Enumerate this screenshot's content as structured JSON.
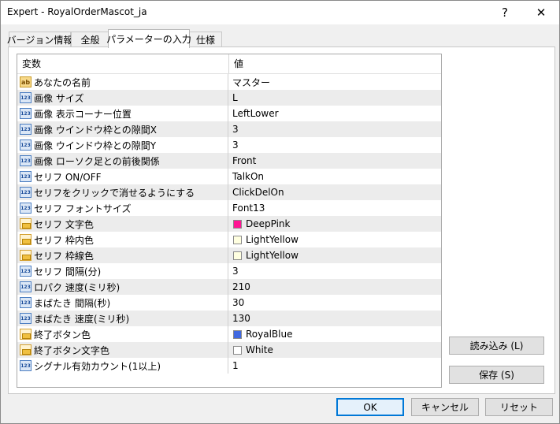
{
  "window": {
    "title": "Expert - RoyalOrderMascot_ja",
    "help_glyph": "?",
    "close_glyph": "✕"
  },
  "tabs": [
    {
      "label": "バージョン情報"
    },
    {
      "label": "全般"
    },
    {
      "label": "パラメーターの入力",
      "active": true
    },
    {
      "label": "仕様"
    }
  ],
  "grid": {
    "col_name": "変数",
    "col_value": "値",
    "rows": [
      {
        "type": "str",
        "name": "あなたの名前",
        "value": "マスター"
      },
      {
        "type": "num",
        "name": "画像 サイズ",
        "value": "L"
      },
      {
        "type": "num",
        "name": "画像 表示コーナー位置",
        "value": "LeftLower"
      },
      {
        "type": "num",
        "name": "画像 ウインドウ枠との隙間X",
        "value": "3"
      },
      {
        "type": "num",
        "name": "画像 ウインドウ枠との隙間Y",
        "value": "3"
      },
      {
        "type": "num",
        "name": "画像 ローソク足との前後関係",
        "value": "Front"
      },
      {
        "type": "num",
        "name": "セリフ ON/OFF",
        "value": "TalkOn"
      },
      {
        "type": "num",
        "name": "セリフをクリックで消せるようにする",
        "value": "ClickDelOn"
      },
      {
        "type": "num",
        "name": "セリフ フォントサイズ",
        "value": "Font13"
      },
      {
        "type": "col",
        "name": "セリフ 文字色",
        "value": "DeepPink",
        "color": "#ff1493"
      },
      {
        "type": "col",
        "name": "セリフ 枠内色",
        "value": "LightYellow",
        "color": "#ffffe0"
      },
      {
        "type": "col",
        "name": "セリフ 枠線色",
        "value": "LightYellow",
        "color": "#ffffe0"
      },
      {
        "type": "num",
        "name": "セリフ 間隔(分)",
        "value": "3"
      },
      {
        "type": "num",
        "name": "ロパク 速度(ミリ秒)",
        "value": "210"
      },
      {
        "type": "num",
        "name": "まばたき 間隔(秒)",
        "value": "30"
      },
      {
        "type": "num",
        "name": "まばたき 速度(ミリ秒)",
        "value": "130"
      },
      {
        "type": "col",
        "name": "終了ボタン色",
        "value": "RoyalBlue",
        "color": "#4169e1"
      },
      {
        "type": "col",
        "name": "終了ボタン文字色",
        "value": "White",
        "color": "#ffffff"
      },
      {
        "type": "num",
        "name": "シグナル有効カウント(1以上)",
        "value": "1"
      }
    ]
  },
  "icons": {
    "num": "123",
    "str": "ab",
    "col": "color-icon"
  },
  "buttons": {
    "load": "読み込み (L)",
    "save": "保存 (S)",
    "ok": "OK",
    "cancel": "キャンセル",
    "reset": "リセット"
  },
  "colors": {
    "accent": "#0078d7"
  }
}
